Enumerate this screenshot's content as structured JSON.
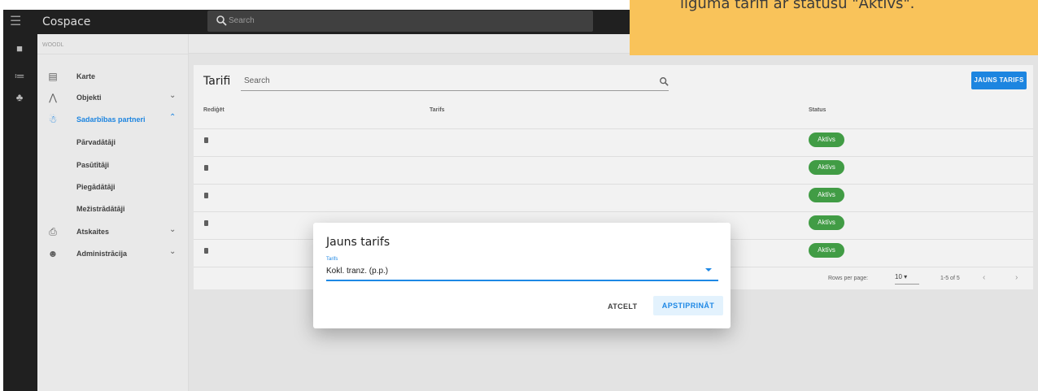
{
  "app": {
    "title": "Cospace",
    "search_placeholder": "Search"
  },
  "sidebar": {
    "org": "WOODL",
    "items": [
      {
        "label": "Karte",
        "icon": "map-icon"
      },
      {
        "label": "Objekti",
        "icon": "forest-icon",
        "chevron": "chevron-down"
      },
      {
        "label": "Sadarbības partneri",
        "icon": "people-icon",
        "chevron": "chevron-up",
        "active": true
      },
      {
        "label": "Atskaites",
        "icon": "report-icon",
        "chevron": "chevron-down"
      },
      {
        "label": "Administrācija",
        "icon": "account-icon",
        "chevron": "chevron-down"
      }
    ],
    "subitems": [
      "Pārvadātāji",
      "Pasūtītāji",
      "Piegādātāji",
      "Mežistrādātāji"
    ]
  },
  "page": {
    "title": "Tarifi",
    "search_placeholder": "Search",
    "new_button": "JAUNS TARIFS",
    "columns": [
      "Rediģēt",
      "Tarifs",
      "Status"
    ],
    "rows": [
      {
        "status": "Aktīvs"
      },
      {
        "status": "Aktīvs"
      },
      {
        "status": "Aktīvs"
      },
      {
        "status": "Aktīvs"
      },
      {
        "status": "Aktīvs"
      }
    ],
    "rows_per_page_label": "Rows per page:",
    "rows_per_page": "10",
    "range": "1-5 of 5"
  },
  "dialog": {
    "title": "Jauns tarifs",
    "field_label": "Tarifs",
    "field_value": "Kokl. tranz. (p.p.)",
    "cancel": "ATCELT",
    "confirm": "APSTIPRINĀT"
  },
  "banner": {
    "text": "līguma tarifi ar statusu \"Aktīvs\"."
  },
  "colors": {
    "accent": "#1e88e5",
    "active_badge": "#43a047",
    "banner": "#f9c35a",
    "topbar": "#212121"
  }
}
